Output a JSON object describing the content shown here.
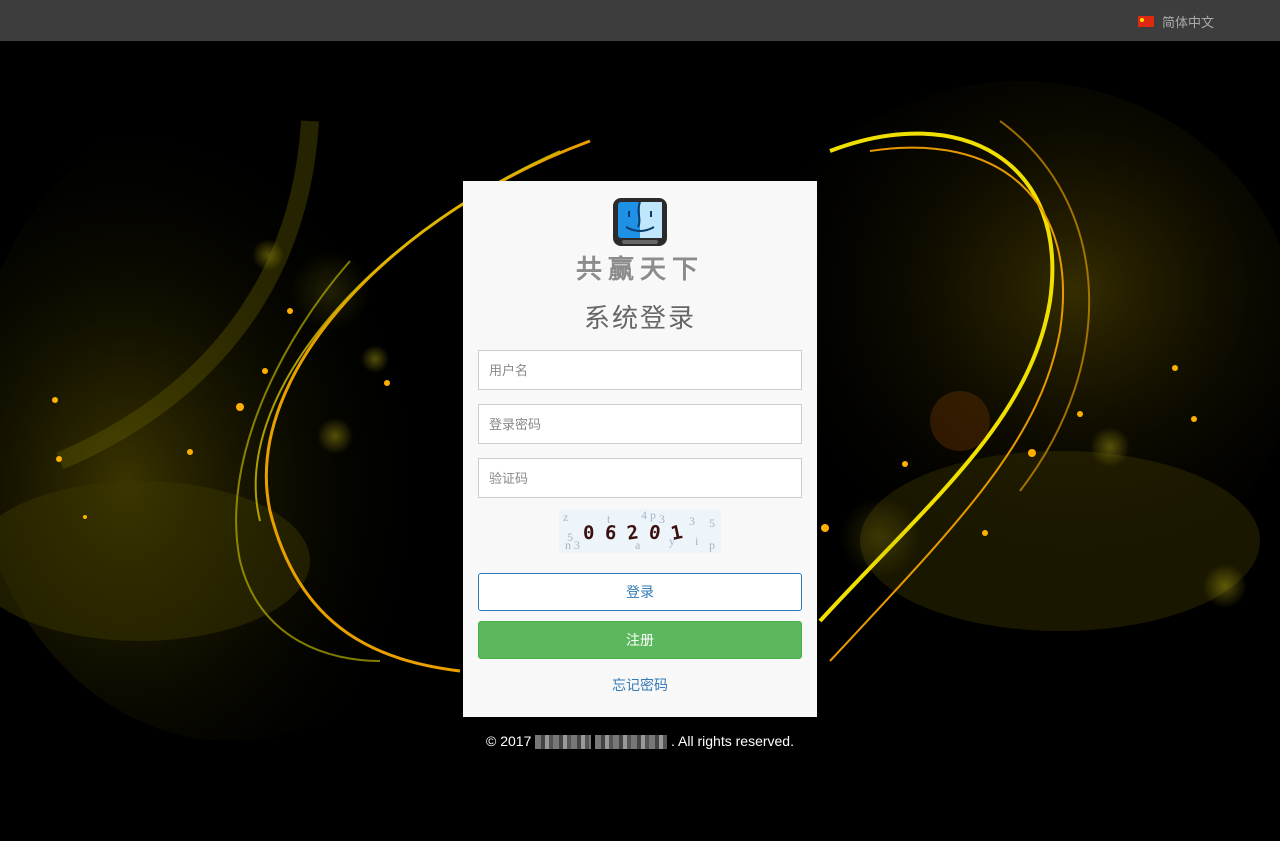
{
  "topbar": {
    "language": "简体中文"
  },
  "login": {
    "brand": "共赢天下",
    "title": "系统登录",
    "username_placeholder": "用户名",
    "password_placeholder": "登录密码",
    "captcha_placeholder": "验证码",
    "captcha_code": "06201",
    "login_button": "登录",
    "register_button": "注册",
    "forgot_link": "忘记密码"
  },
  "footer": {
    "prefix": "© 2017",
    "suffix": ". All rights reserved."
  },
  "colors": {
    "primary": "#337ab7",
    "success": "#5cb85c",
    "topbar": "#3e3d3d"
  }
}
